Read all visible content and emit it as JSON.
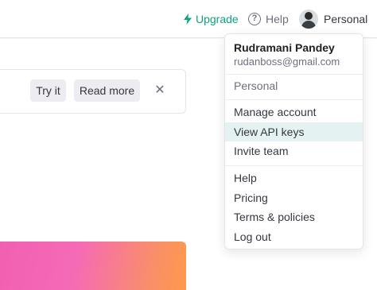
{
  "header": {
    "upgrade_label": "Upgrade",
    "help_label": "Help",
    "personal_label": "Personal",
    "upgrade_icon": "bolt-icon",
    "help_icon": "question-circle-icon"
  },
  "notice": {
    "try_label": "Try it",
    "read_more_label": "Read more",
    "close_glyph": "✕"
  },
  "menu": {
    "user_name": "Rudramani Pandey",
    "user_email": "rudanboss@gmail.com",
    "organization": "Personal",
    "account_items": [
      "Manage account",
      "View API keys",
      "Invite team"
    ],
    "support_items": [
      "Help",
      "Pricing",
      "Terms & policies",
      "Log out"
    ],
    "active_item": "View API keys"
  },
  "colors": {
    "accent_green": "#10a37f",
    "menu_active_bg": "#e5f2f2",
    "banner_gradient": [
      "#f25fb2",
      "#ff9a4a"
    ]
  }
}
